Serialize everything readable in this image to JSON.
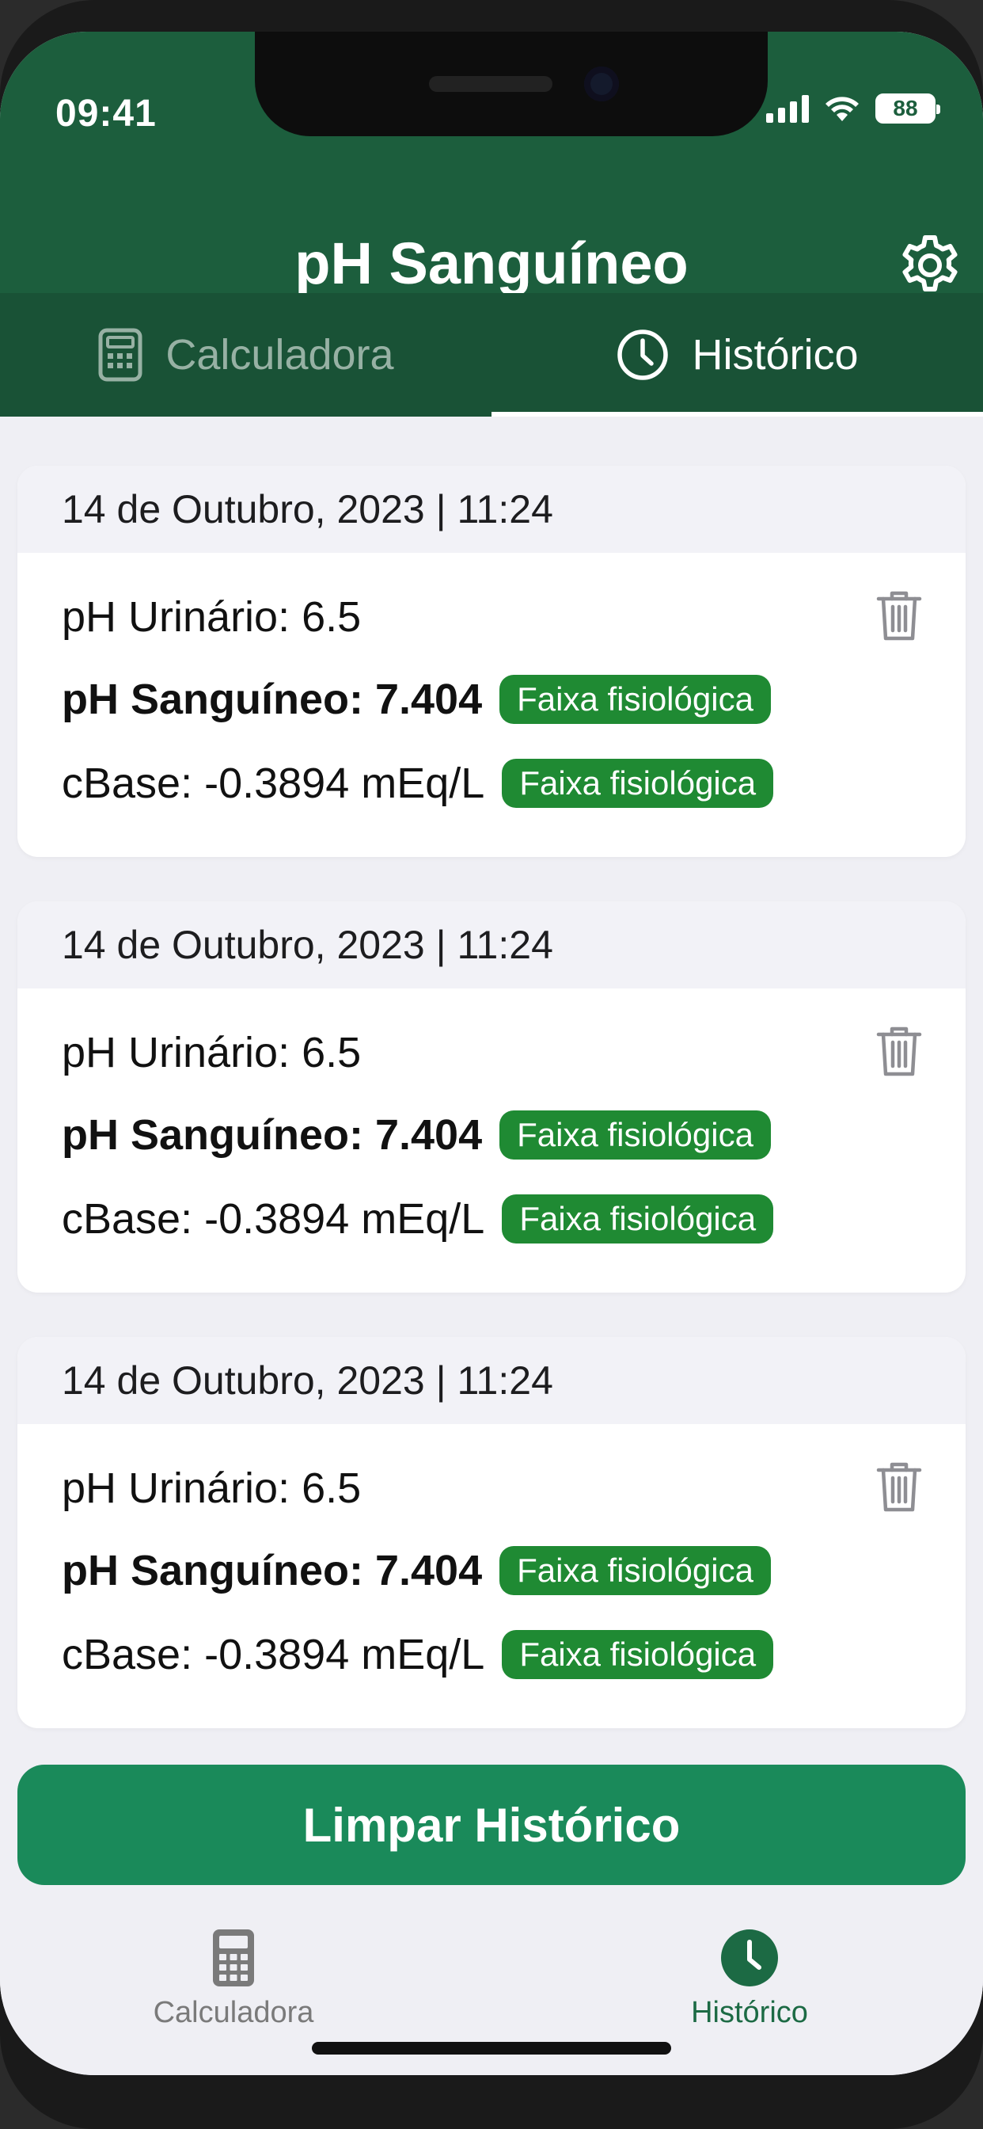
{
  "status_bar": {
    "time": "09:41",
    "battery": "88"
  },
  "header": {
    "title": "pH Sanguíneo"
  },
  "tabs": [
    {
      "label": "Calculadora",
      "active": false
    },
    {
      "label": "Histórico",
      "active": true
    }
  ],
  "history": [
    {
      "datetime": "14 de Outubro, 2023 | 11:24",
      "urinary": "pH Urinário: 6.5",
      "blood": "pH Sanguíneo: 7.404",
      "blood_badge": "Faixa fisiológica",
      "cbase": "cBase: -0.3894 mEq/L",
      "cbase_badge": "Faixa fisiológica"
    },
    {
      "datetime": "14 de Outubro, 2023 | 11:24",
      "urinary": "pH Urinário: 6.5",
      "blood": "pH Sanguíneo: 7.404",
      "blood_badge": "Faixa fisiológica",
      "cbase": "cBase: -0.3894 mEq/L",
      "cbase_badge": "Faixa fisiológica"
    },
    {
      "datetime": "14 de Outubro, 2023 | 11:24",
      "urinary": "pH Urinário: 6.5",
      "blood": "pH Sanguíneo: 7.404",
      "blood_badge": "Faixa fisiológica",
      "cbase": "cBase: -0.3894 mEq/L",
      "cbase_badge": "Faixa fisiológica"
    }
  ],
  "clear_button": {
    "label": "Limpar Histórico"
  },
  "tabbar": [
    {
      "label": "Calculadora",
      "icon": "calculator-icon",
      "active": false
    },
    {
      "label": "Histórico",
      "icon": "clock-icon",
      "active": true
    }
  ],
  "colors": {
    "header_green": "#1c5e3d",
    "tabs_green": "#195236",
    "badge_green": "#1f8a33",
    "button_green": "#1a8a5a",
    "active_tab_green": "#1c6a44"
  }
}
